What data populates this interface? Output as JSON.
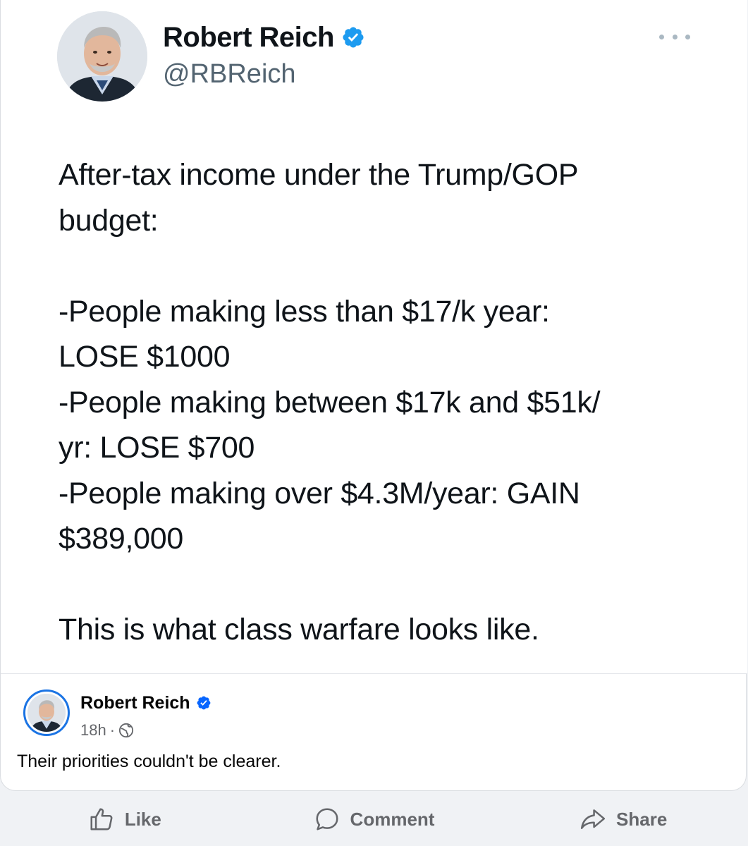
{
  "tweet": {
    "author_name": "Robert Reich",
    "handle": "@RBReich",
    "body_lines": [
      "After-tax income under the Trump/GOP",
      "budget:",
      "",
      "-People making less than $17/k year:",
      "LOSE $1000",
      "-People making between $17k and $51k/",
      "yr: LOSE $700",
      "-People making over $4.3M/year: GAIN",
      "$389,000",
      "",
      "This is what class warfare looks like."
    ]
  },
  "post": {
    "author_name": "Robert Reich",
    "time": "18h",
    "separator": "·",
    "caption": "Their priorities couldn't be clearer."
  },
  "actions": {
    "like_label": "Like",
    "comment_label": "Comment",
    "share_label": "Share"
  },
  "colors": {
    "verified": "#1d9bf0",
    "fb_verified": "#0866ff",
    "muted": "#65676b"
  },
  "icons": {
    "verified": "verified-badge-icon",
    "more": "more-options-icon",
    "globe": "globe-icon",
    "like": "thumbs-up-icon",
    "comment": "comment-bubble-icon",
    "share": "share-arrow-icon"
  }
}
